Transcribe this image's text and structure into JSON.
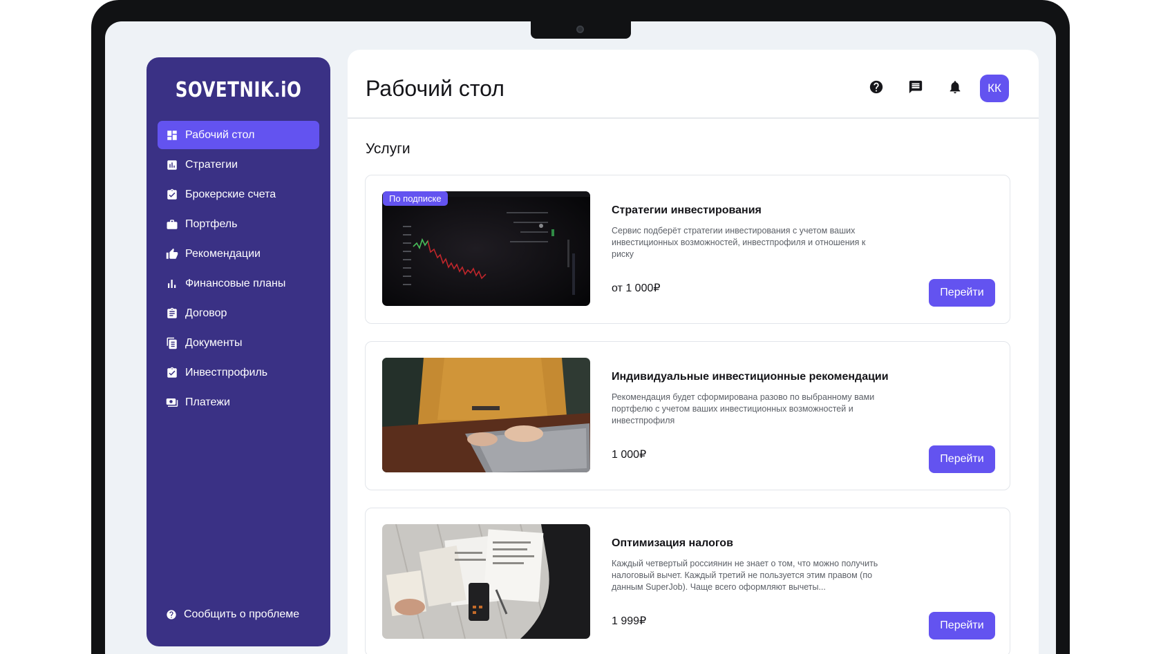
{
  "sidebar": {
    "logo": "SOVETNIK.iO",
    "items": [
      {
        "label": "Рабочий стол",
        "icon": "dashboard-icon",
        "active": true
      },
      {
        "label": "Стратегии",
        "icon": "bar-chart-icon",
        "active": false
      },
      {
        "label": "Брокерские счета",
        "icon": "clipboard-check-icon",
        "active": false
      },
      {
        "label": "Портфель",
        "icon": "briefcase-icon",
        "active": false
      },
      {
        "label": "Рекомендации",
        "icon": "thumb-up-icon",
        "active": false
      },
      {
        "label": "Финансовые планы",
        "icon": "stats-icon",
        "active": false
      },
      {
        "label": "Договор",
        "icon": "contract-icon",
        "active": false
      },
      {
        "label": "Документы",
        "icon": "documents-icon",
        "active": false
      },
      {
        "label": "Инвестпрофиль",
        "icon": "profile-check-icon",
        "active": false
      },
      {
        "label": "Платежи",
        "icon": "payments-icon",
        "active": false
      }
    ],
    "report_label": "Сообщить о проблеме"
  },
  "header": {
    "title": "Рабочий стол",
    "avatar_initials": "КК"
  },
  "services": {
    "title": "Услуги",
    "cards": [
      {
        "badge": "По подписке",
        "title": "Стратегии инвестирования",
        "description": "Сервис подберёт стратегии инвестирования с учетом ваших инвестиционных возможностей, инвестпрофиля и отношения к риску",
        "price": "от 1 000₽",
        "button": "Перейти"
      },
      {
        "title": "Индивидуальные инвестиционные рекомендации",
        "description": "Рекомендация будет сформирована разово по выбранному вами портфелю с учетом ваших инвестиционных возможностей и инвестпрофиля",
        "price": "1 000₽",
        "button": "Перейти"
      },
      {
        "title": "Оптимизация налогов",
        "description": "Каждый четвертый россиянин не знает о том, что можно получить налоговый вычет. Каждый третий не пользуется этим правом (по данным SuperJob). Чаще всего оформляют вычеты...",
        "price": "1 999₽",
        "button": "Перейти"
      }
    ]
  },
  "colors": {
    "sidebar_bg": "#3a3185",
    "accent": "#6353f0",
    "screen_bg": "#eef2f6"
  }
}
